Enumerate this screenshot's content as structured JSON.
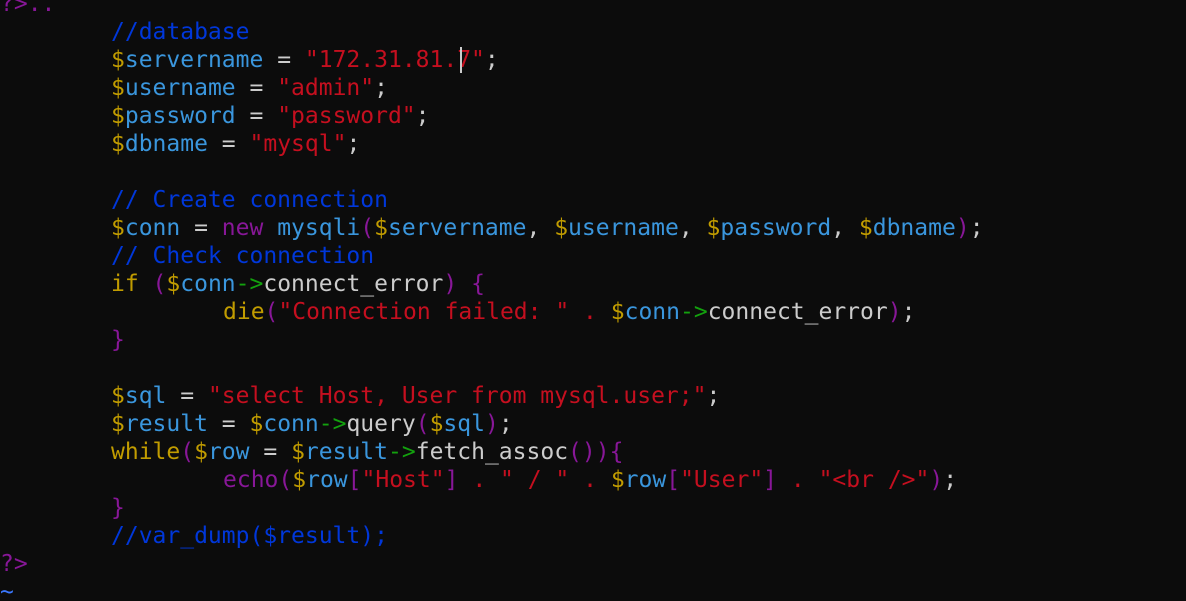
{
  "editor": {
    "lines": [
      {
        "indent": 0,
        "tokens": [
          {
            "t": "?>",
            "c": "kw"
          },
          {
            "t": "..",
            "c": "kw"
          }
        ]
      },
      {
        "indent": 1,
        "tokens": [
          {
            "t": "//database",
            "c": "comment"
          }
        ]
      },
      {
        "indent": 1,
        "tokens": [
          {
            "t": "$",
            "c": "dollar"
          },
          {
            "t": "servername",
            "c": "var"
          },
          {
            "t": " = ",
            "c": "plain"
          },
          {
            "t": "\"172.31.81.7\"",
            "c": "str"
          },
          {
            "t": ";",
            "c": "plain"
          }
        ]
      },
      {
        "indent": 1,
        "tokens": [
          {
            "t": "$",
            "c": "dollar"
          },
          {
            "t": "username",
            "c": "var"
          },
          {
            "t": " = ",
            "c": "plain"
          },
          {
            "t": "\"admin\"",
            "c": "str"
          },
          {
            "t": ";",
            "c": "plain"
          }
        ]
      },
      {
        "indent": 1,
        "tokens": [
          {
            "t": "$",
            "c": "dollar"
          },
          {
            "t": "password",
            "c": "var"
          },
          {
            "t": " = ",
            "c": "plain"
          },
          {
            "t": "\"password\"",
            "c": "str"
          },
          {
            "t": ";",
            "c": "plain"
          }
        ]
      },
      {
        "indent": 1,
        "tokens": [
          {
            "t": "$",
            "c": "dollar"
          },
          {
            "t": "dbname",
            "c": "var"
          },
          {
            "t": " = ",
            "c": "plain"
          },
          {
            "t": "\"mysql\"",
            "c": "str"
          },
          {
            "t": ";",
            "c": "plain"
          }
        ]
      },
      {
        "indent": 0,
        "tokens": []
      },
      {
        "indent": 1,
        "tokens": [
          {
            "t": "// Create connection",
            "c": "comment"
          }
        ]
      },
      {
        "indent": 1,
        "tokens": [
          {
            "t": "$",
            "c": "dollar"
          },
          {
            "t": "conn",
            "c": "var"
          },
          {
            "t": " = ",
            "c": "plain"
          },
          {
            "t": "new",
            "c": "kw"
          },
          {
            "t": " mysqli",
            "c": "var"
          },
          {
            "t": "(",
            "c": "kw"
          },
          {
            "t": "$",
            "c": "dollar"
          },
          {
            "t": "servername",
            "c": "var"
          },
          {
            "t": ", ",
            "c": "plain"
          },
          {
            "t": "$",
            "c": "dollar"
          },
          {
            "t": "username",
            "c": "var"
          },
          {
            "t": ", ",
            "c": "plain"
          },
          {
            "t": "$",
            "c": "dollar"
          },
          {
            "t": "password",
            "c": "var"
          },
          {
            "t": ", ",
            "c": "plain"
          },
          {
            "t": "$",
            "c": "dollar"
          },
          {
            "t": "dbname",
            "c": "var"
          },
          {
            "t": ")",
            "c": "kw"
          },
          {
            "t": ";",
            "c": "plain"
          }
        ]
      },
      {
        "indent": 1,
        "tokens": [
          {
            "t": "// Check connection",
            "c": "comment"
          }
        ]
      },
      {
        "indent": 1,
        "tokens": [
          {
            "t": "if",
            "c": "dollar"
          },
          {
            "t": " (",
            "c": "kw"
          },
          {
            "t": "$",
            "c": "dollar"
          },
          {
            "t": "conn",
            "c": "var"
          },
          {
            "t": "->",
            "c": "arrow"
          },
          {
            "t": "connect_error",
            "c": "plain"
          },
          {
            "t": ")",
            "c": "kw"
          },
          {
            "t": " {",
            "c": "kw"
          }
        ]
      },
      {
        "indent": 2,
        "tokens": [
          {
            "t": "die",
            "c": "dollar"
          },
          {
            "t": "(",
            "c": "kw"
          },
          {
            "t": "\"Connection failed: \"",
            "c": "str"
          },
          {
            "t": " . ",
            "c": "str"
          },
          {
            "t": "$",
            "c": "dollar"
          },
          {
            "t": "conn",
            "c": "var"
          },
          {
            "t": "->",
            "c": "arrow"
          },
          {
            "t": "connect_error",
            "c": "plain"
          },
          {
            "t": ")",
            "c": "kw"
          },
          {
            "t": ";",
            "c": "plain"
          }
        ]
      },
      {
        "indent": 1,
        "tokens": [
          {
            "t": "}",
            "c": "kw"
          }
        ]
      },
      {
        "indent": 0,
        "tokens": []
      },
      {
        "indent": 1,
        "tokens": [
          {
            "t": "$",
            "c": "dollar"
          },
          {
            "t": "sql",
            "c": "var"
          },
          {
            "t": " = ",
            "c": "plain"
          },
          {
            "t": "\"select Host, User from mysql.user;\"",
            "c": "str"
          },
          {
            "t": ";",
            "c": "plain"
          }
        ]
      },
      {
        "indent": 1,
        "tokens": [
          {
            "t": "$",
            "c": "dollar"
          },
          {
            "t": "result",
            "c": "var"
          },
          {
            "t": " = ",
            "c": "plain"
          },
          {
            "t": "$",
            "c": "dollar"
          },
          {
            "t": "conn",
            "c": "var"
          },
          {
            "t": "->",
            "c": "arrow"
          },
          {
            "t": "query",
            "c": "plain"
          },
          {
            "t": "(",
            "c": "kw"
          },
          {
            "t": "$",
            "c": "dollar"
          },
          {
            "t": "sql",
            "c": "var"
          },
          {
            "t": ")",
            "c": "kw"
          },
          {
            "t": ";",
            "c": "plain"
          }
        ]
      },
      {
        "indent": 1,
        "tokens": [
          {
            "t": "while",
            "c": "dollar"
          },
          {
            "t": "(",
            "c": "kw"
          },
          {
            "t": "$",
            "c": "dollar"
          },
          {
            "t": "row",
            "c": "var"
          },
          {
            "t": " = ",
            "c": "plain"
          },
          {
            "t": "$",
            "c": "dollar"
          },
          {
            "t": "result",
            "c": "var"
          },
          {
            "t": "->",
            "c": "arrow"
          },
          {
            "t": "fetch_assoc",
            "c": "plain"
          },
          {
            "t": "()){",
            "c": "kw"
          }
        ]
      },
      {
        "indent": 2,
        "tokens": [
          {
            "t": "echo",
            "c": "kw"
          },
          {
            "t": "(",
            "c": "kw"
          },
          {
            "t": "$",
            "c": "dollar"
          },
          {
            "t": "row",
            "c": "var"
          },
          {
            "t": "[",
            "c": "kw"
          },
          {
            "t": "\"Host\"",
            "c": "str"
          },
          {
            "t": "]",
            "c": "kw"
          },
          {
            "t": " . ",
            "c": "str"
          },
          {
            "t": "\" / \"",
            "c": "str"
          },
          {
            "t": " . ",
            "c": "str"
          },
          {
            "t": "$",
            "c": "dollar"
          },
          {
            "t": "row",
            "c": "var"
          },
          {
            "t": "[",
            "c": "kw"
          },
          {
            "t": "\"User\"",
            "c": "str"
          },
          {
            "t": "]",
            "c": "kw"
          },
          {
            "t": " . ",
            "c": "str"
          },
          {
            "t": "\"<br />\"",
            "c": "str"
          },
          {
            "t": ")",
            "c": "kw"
          },
          {
            "t": ";",
            "c": "plain"
          }
        ]
      },
      {
        "indent": 1,
        "tokens": [
          {
            "t": "}",
            "c": "kw"
          }
        ]
      },
      {
        "indent": 1,
        "tokens": [
          {
            "t": "//var_dump($result);",
            "c": "comment"
          }
        ]
      },
      {
        "indent": 0,
        "tokens": [
          {
            "t": "?>",
            "c": "kw"
          }
        ]
      },
      {
        "indent": 0,
        "tokens": [
          {
            "t": "~",
            "c": "tilde"
          }
        ]
      }
    ]
  },
  "colors": {
    "background": "#0c0c0c",
    "comment": "#0037da",
    "dollar": "#c19c00",
    "var": "#3a96dd",
    "str": "#c50f1f",
    "kw": "#881798",
    "arrow": "#13a10e",
    "plain": "#cccccc",
    "tilde": "#3b78ff"
  }
}
